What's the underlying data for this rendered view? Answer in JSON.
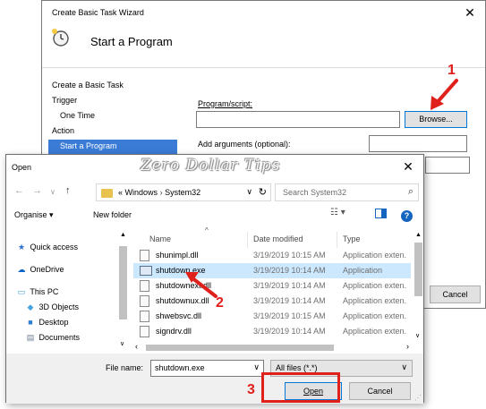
{
  "wizard": {
    "title": "Create Basic Task Wizard",
    "header": "Start a Program",
    "nav": [
      "Create a Basic Task",
      "Trigger",
      "One Time",
      "Action",
      "Start a Program"
    ],
    "program_label": "Program/script:",
    "program_label_underline": "P",
    "args_label": "Add arguments (optional):",
    "browse_label": "Browse...",
    "cancel_label": "Cancel"
  },
  "dialog": {
    "title": "Open",
    "watermark": "Zero Dollar Tips",
    "path": [
      "«",
      "Windows",
      "›",
      "System32"
    ],
    "search_placeholder": "Search System32",
    "organise_label": "Organise ▾",
    "new_folder_label": "New folder",
    "tree": [
      {
        "label": "Quick access",
        "icon": "star-icon",
        "color": "#2f6fd6"
      },
      {
        "label": "OneDrive",
        "icon": "cloud-icon",
        "color": "#0a64c8"
      },
      {
        "label": "This PC",
        "icon": "monitor-icon",
        "color": "#3b9ad9"
      },
      {
        "label": "3D Objects",
        "icon": "cube-icon",
        "color": "#4aa3df"
      },
      {
        "label": "Desktop",
        "icon": "desktop-icon",
        "color": "#2e7fd1"
      },
      {
        "label": "Documents",
        "icon": "document-icon",
        "color": "#6b7c93"
      }
    ],
    "columns": [
      "Name",
      "Date modified",
      "Type"
    ],
    "files": [
      {
        "name": "shunimpl.dll",
        "date": "3/19/2019 10:15 AM",
        "type": "Application exten.",
        "kind": "dll",
        "selected": false
      },
      {
        "name": "shutdown.exe",
        "date": "3/19/2019 10:14 AM",
        "type": "Application",
        "kind": "exe",
        "selected": true
      },
      {
        "name": "shutdownext.dll",
        "date": "3/19/2019 10:14 AM",
        "type": "Application exten.",
        "kind": "dll",
        "selected": false
      },
      {
        "name": "shutdownux.dll",
        "date": "3/19/2019 10:14 AM",
        "type": "Application exten.",
        "kind": "dll",
        "selected": false
      },
      {
        "name": "shwebsvc.dll",
        "date": "3/19/2019 10:15 AM",
        "type": "Application exten.",
        "kind": "dll",
        "selected": false
      },
      {
        "name": "signdrv.dll",
        "date": "3/19/2019 10:14 AM",
        "type": "Application exten.",
        "kind": "dll",
        "selected": false
      }
    ],
    "file_name_label": "File name:",
    "file_name_value": "shutdown.exe",
    "filter_value": "All files (*.*)",
    "open_label": "Open",
    "cancel_label": "Cancel"
  },
  "annotations": {
    "step1": "1",
    "step2": "2",
    "step3": "3",
    "color": "#e0201b"
  }
}
